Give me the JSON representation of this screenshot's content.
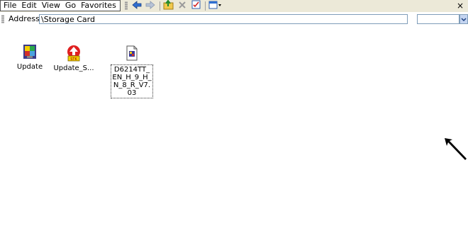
{
  "menu": {
    "file": "File",
    "edit": "Edit",
    "view": "View",
    "go": "Go",
    "favorites": "Favorites"
  },
  "toolbar": {
    "icons": [
      "back-arrow-icon",
      "forward-arrow-icon",
      "up-folder-icon",
      "delete-icon",
      "properties-icon",
      "views-icon"
    ],
    "close": "×"
  },
  "address": {
    "label": "Address",
    "value": "\\Storage Card"
  },
  "files": [
    {
      "label": "Update",
      "icon": "update-app-icon"
    },
    {
      "label": "Update_S...",
      "icon": "stk-update-icon"
    },
    {
      "label": "D6214TT_EN_H_9_H_N_8_R_V7.03",
      "icon": "media-file-icon"
    }
  ],
  "colors": {
    "toolbar_bg": "#ece9d8",
    "address_border": "#7f9db9"
  }
}
